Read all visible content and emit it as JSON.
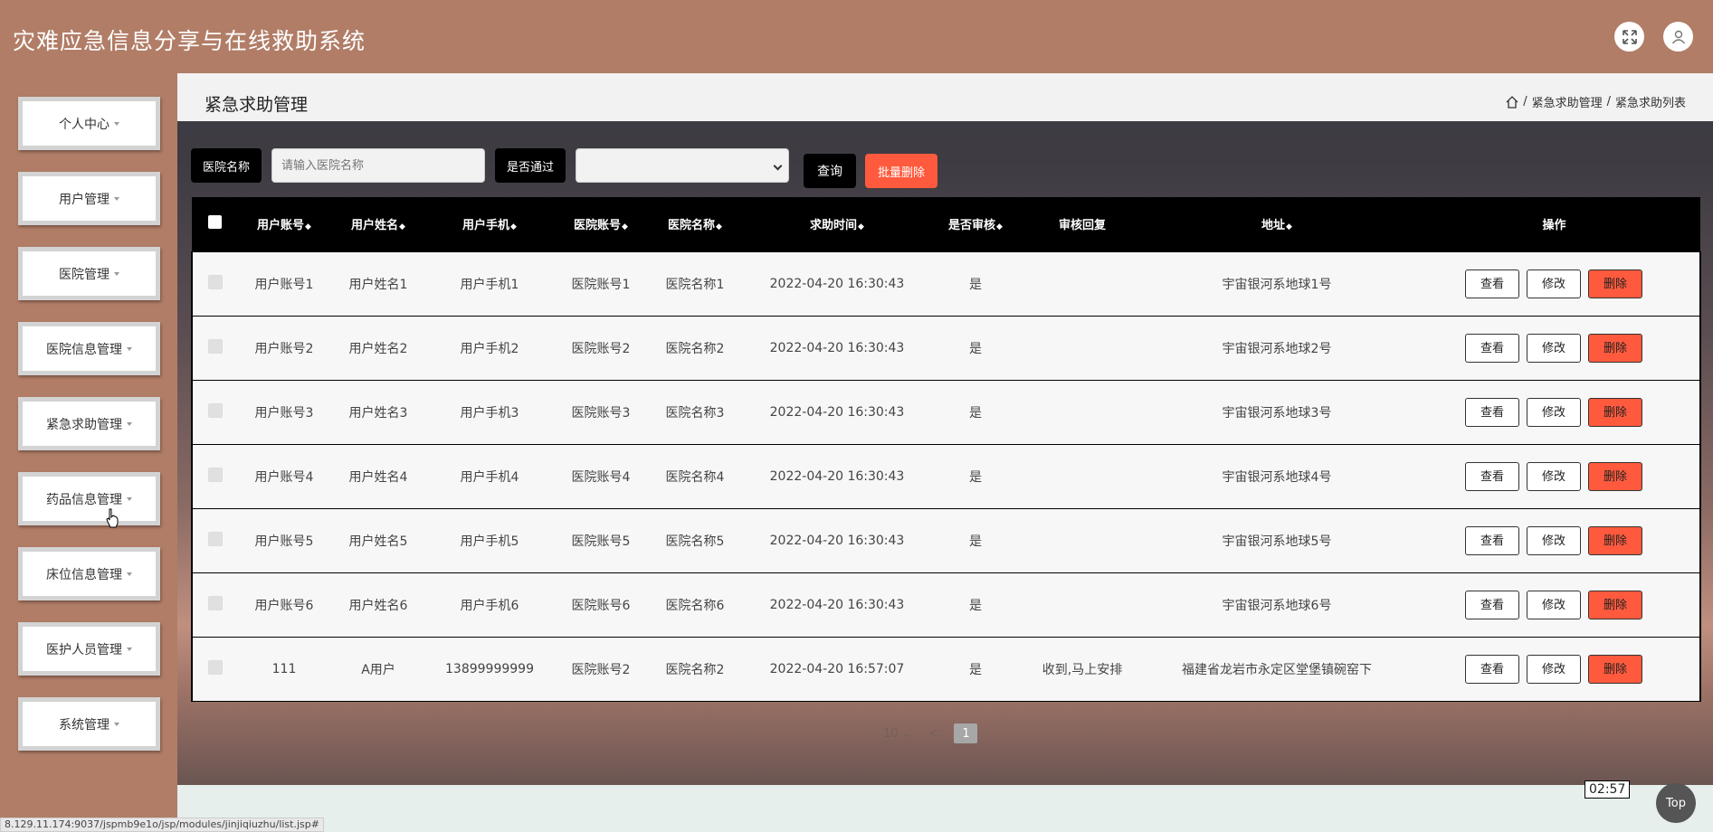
{
  "app": {
    "title": "灾难应急信息分享与在线救助系统"
  },
  "header_icons": [
    "fullscreen-icon",
    "user-icon"
  ],
  "sidebar": {
    "items": [
      {
        "label": "个人中心"
      },
      {
        "label": "用户管理"
      },
      {
        "label": "医院管理"
      },
      {
        "label": "医院信息管理"
      },
      {
        "label": "紧急求助管理"
      },
      {
        "label": "药品信息管理"
      },
      {
        "label": "床位信息管理"
      },
      {
        "label": "医护人员管理"
      },
      {
        "label": "系统管理"
      }
    ]
  },
  "page": {
    "title": "紧急求助管理",
    "breadcrumb": [
      "紧急求助管理",
      "紧急求助列表"
    ]
  },
  "filters": {
    "hospital_name_label": "医院名称",
    "hospital_name_placeholder": "请输入医院名称",
    "approved_label": "是否通过",
    "approved_value": "",
    "query_label": "查询",
    "batch_delete_label": "批量删除"
  },
  "table": {
    "columns": [
      "用户账号",
      "用户姓名",
      "用户手机",
      "医院账号",
      "医院名称",
      "求助时间",
      "是否审核",
      "审核回复",
      "地址",
      "操作"
    ],
    "actions": {
      "view": "查看",
      "edit": "修改",
      "delete": "删除"
    },
    "rows": [
      {
        "account": "用户账号1",
        "name": "用户姓名1",
        "phone": "用户手机1",
        "hospital_account": "医院账号1",
        "hospital_name": "医院名称1",
        "time": "2022-04-20 16:30:43",
        "audited": "是",
        "reply": "",
        "address": "宇宙银河系地球1号"
      },
      {
        "account": "用户账号2",
        "name": "用户姓名2",
        "phone": "用户手机2",
        "hospital_account": "医院账号2",
        "hospital_name": "医院名称2",
        "time": "2022-04-20 16:30:43",
        "audited": "是",
        "reply": "",
        "address": "宇宙银河系地球2号"
      },
      {
        "account": "用户账号3",
        "name": "用户姓名3",
        "phone": "用户手机3",
        "hospital_account": "医院账号3",
        "hospital_name": "医院名称3",
        "time": "2022-04-20 16:30:43",
        "audited": "是",
        "reply": "",
        "address": "宇宙银河系地球3号"
      },
      {
        "account": "用户账号4",
        "name": "用户姓名4",
        "phone": "用户手机4",
        "hospital_account": "医院账号4",
        "hospital_name": "医院名称4",
        "time": "2022-04-20 16:30:43",
        "audited": "是",
        "reply": "",
        "address": "宇宙银河系地球4号"
      },
      {
        "account": "用户账号5",
        "name": "用户姓名5",
        "phone": "用户手机5",
        "hospital_account": "医院账号5",
        "hospital_name": "医院名称5",
        "time": "2022-04-20 16:30:43",
        "audited": "是",
        "reply": "",
        "address": "宇宙银河系地球5号"
      },
      {
        "account": "用户账号6",
        "name": "用户姓名6",
        "phone": "用户手机6",
        "hospital_account": "医院账号6",
        "hospital_name": "医院名称6",
        "time": "2022-04-20 16:30:43",
        "audited": "是",
        "reply": "",
        "address": "宇宙银河系地球6号"
      },
      {
        "account": "111",
        "name": "A用户",
        "phone": "13899999999",
        "hospital_account": "医院账号2",
        "hospital_name": "医院名称2",
        "time": "2022-04-20 16:57:07",
        "audited": "是",
        "reply": "收到,马上安排",
        "address": "福建省龙岩市永定区堂堡镇碗窑下"
      }
    ]
  },
  "pagination": {
    "page_size": "10",
    "current_page": "1"
  },
  "video_time": "02:57",
  "top_button": "Top",
  "status_url": "8.129.11.174:9037/jspmb9e1o/jsp/modules/jinjiqiuzhu/list.jsp#",
  "colors": {
    "brand": "#b17d67",
    "danger": "#ff5a3d",
    "header_black": "#000000"
  }
}
